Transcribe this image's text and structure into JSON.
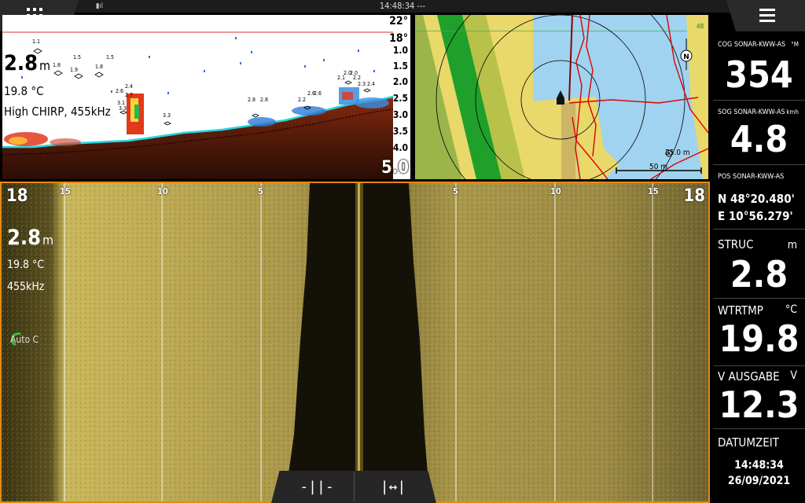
{
  "topbar": {
    "clock": "14:48:34 ---",
    "signal_icon": "signal-icon",
    "apps_icon": "apps-grid-icon",
    "menu_icon": "hamburger-menu-icon"
  },
  "sonar": {
    "depth_value": "2.8",
    "depth_unit": "m",
    "temperature": "19.8 °C",
    "frequency": "High CHIRP, 455kHz",
    "temp_top": "22°",
    "temp_second": "18°",
    "depth_scale": [
      "1.0",
      "1.5",
      "2.0",
      "2.5",
      "3.0",
      "3.5",
      "4.0"
    ],
    "scale_max": "5.0",
    "fish_labels": [
      "1.1",
      "1.8",
      "1.5",
      "1.9",
      "1.8",
      "1.5",
      "2.6",
      "2.4",
      "2.7",
      "3.3",
      "3.1",
      "3.3",
      "2.8",
      "2.8",
      "2.2",
      "2.6",
      "2.6",
      "2.1",
      "2.0",
      "2.2",
      "2.0",
      "2.3",
      "2.4"
    ]
  },
  "chart": {
    "range_ring": "25.0 m",
    "scale_bar": "50 m",
    "waypoint_label": "48",
    "north_icon": "north-arrow-icon",
    "range_icon": "range-ring-icon",
    "colors": {
      "water": "#9fd3ef",
      "land": "#e9d86a",
      "green": "#1fa02a",
      "track": "#e00000"
    }
  },
  "sideimage": {
    "range_outer": "18",
    "range_labels_left": [
      "15",
      "10",
      "5"
    ],
    "range_labels_right": [
      "5",
      "10",
      "15"
    ],
    "depth_value": "2.8",
    "depth_unit": "m",
    "temperature": "19.8 °C",
    "frequency": "455kHz",
    "auto_label": "Auto",
    "auto_suffix": "C"
  },
  "controls": {
    "left_button_glyph": "-||-",
    "right_button_glyph": "|↔|"
  },
  "databar": {
    "cog": {
      "label": "COG SONAR-KWW-AS",
      "unit": "°M",
      "value": "354"
    },
    "sog": {
      "label": "SOG SONAR-KWW-AS",
      "unit": "kmh",
      "value": "4.8"
    },
    "pos": {
      "label": "POS SONAR-KWW-AS",
      "lat": "N  48°20.480'",
      "lon": "E  10°56.279'"
    },
    "struc": {
      "label": "STRUC",
      "unit": "m",
      "value": "2.8"
    },
    "wtrtmp": {
      "label": "WTRTMP",
      "unit": "°C",
      "value": "19.8"
    },
    "vausgabe": {
      "label": "V AUSGABE",
      "unit": "V",
      "value": "12.3"
    },
    "datumzeit": {
      "label": "DATUMZEIT",
      "time": "14:48:34",
      "date": "26/09/2021"
    }
  }
}
